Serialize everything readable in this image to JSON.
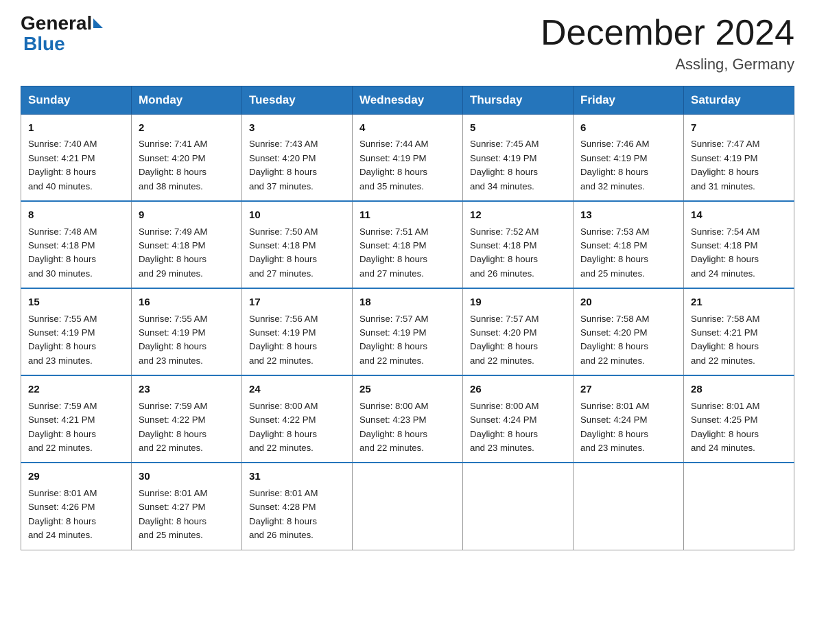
{
  "header": {
    "logo_general": "General",
    "logo_blue": "Blue",
    "month_title": "December 2024",
    "location": "Assling, Germany"
  },
  "weekdays": [
    "Sunday",
    "Monday",
    "Tuesday",
    "Wednesday",
    "Thursday",
    "Friday",
    "Saturday"
  ],
  "weeks": [
    [
      {
        "day": "1",
        "sunrise": "7:40 AM",
        "sunset": "4:21 PM",
        "daylight": "8 hours and 40 minutes."
      },
      {
        "day": "2",
        "sunrise": "7:41 AM",
        "sunset": "4:20 PM",
        "daylight": "8 hours and 38 minutes."
      },
      {
        "day": "3",
        "sunrise": "7:43 AM",
        "sunset": "4:20 PM",
        "daylight": "8 hours and 37 minutes."
      },
      {
        "day": "4",
        "sunrise": "7:44 AM",
        "sunset": "4:19 PM",
        "daylight": "8 hours and 35 minutes."
      },
      {
        "day": "5",
        "sunrise": "7:45 AM",
        "sunset": "4:19 PM",
        "daylight": "8 hours and 34 minutes."
      },
      {
        "day": "6",
        "sunrise": "7:46 AM",
        "sunset": "4:19 PM",
        "daylight": "8 hours and 32 minutes."
      },
      {
        "day": "7",
        "sunrise": "7:47 AM",
        "sunset": "4:19 PM",
        "daylight": "8 hours and 31 minutes."
      }
    ],
    [
      {
        "day": "8",
        "sunrise": "7:48 AM",
        "sunset": "4:18 PM",
        "daylight": "8 hours and 30 minutes."
      },
      {
        "day": "9",
        "sunrise": "7:49 AM",
        "sunset": "4:18 PM",
        "daylight": "8 hours and 29 minutes."
      },
      {
        "day": "10",
        "sunrise": "7:50 AM",
        "sunset": "4:18 PM",
        "daylight": "8 hours and 27 minutes."
      },
      {
        "day": "11",
        "sunrise": "7:51 AM",
        "sunset": "4:18 PM",
        "daylight": "8 hours and 27 minutes."
      },
      {
        "day": "12",
        "sunrise": "7:52 AM",
        "sunset": "4:18 PM",
        "daylight": "8 hours and 26 minutes."
      },
      {
        "day": "13",
        "sunrise": "7:53 AM",
        "sunset": "4:18 PM",
        "daylight": "8 hours and 25 minutes."
      },
      {
        "day": "14",
        "sunrise": "7:54 AM",
        "sunset": "4:18 PM",
        "daylight": "8 hours and 24 minutes."
      }
    ],
    [
      {
        "day": "15",
        "sunrise": "7:55 AM",
        "sunset": "4:19 PM",
        "daylight": "8 hours and 23 minutes."
      },
      {
        "day": "16",
        "sunrise": "7:55 AM",
        "sunset": "4:19 PM",
        "daylight": "8 hours and 23 minutes."
      },
      {
        "day": "17",
        "sunrise": "7:56 AM",
        "sunset": "4:19 PM",
        "daylight": "8 hours and 22 minutes."
      },
      {
        "day": "18",
        "sunrise": "7:57 AM",
        "sunset": "4:19 PM",
        "daylight": "8 hours and 22 minutes."
      },
      {
        "day": "19",
        "sunrise": "7:57 AM",
        "sunset": "4:20 PM",
        "daylight": "8 hours and 22 minutes."
      },
      {
        "day": "20",
        "sunrise": "7:58 AM",
        "sunset": "4:20 PM",
        "daylight": "8 hours and 22 minutes."
      },
      {
        "day": "21",
        "sunrise": "7:58 AM",
        "sunset": "4:21 PM",
        "daylight": "8 hours and 22 minutes."
      }
    ],
    [
      {
        "day": "22",
        "sunrise": "7:59 AM",
        "sunset": "4:21 PM",
        "daylight": "8 hours and 22 minutes."
      },
      {
        "day": "23",
        "sunrise": "7:59 AM",
        "sunset": "4:22 PM",
        "daylight": "8 hours and 22 minutes."
      },
      {
        "day": "24",
        "sunrise": "8:00 AM",
        "sunset": "4:22 PM",
        "daylight": "8 hours and 22 minutes."
      },
      {
        "day": "25",
        "sunrise": "8:00 AM",
        "sunset": "4:23 PM",
        "daylight": "8 hours and 22 minutes."
      },
      {
        "day": "26",
        "sunrise": "8:00 AM",
        "sunset": "4:24 PM",
        "daylight": "8 hours and 23 minutes."
      },
      {
        "day": "27",
        "sunrise": "8:01 AM",
        "sunset": "4:24 PM",
        "daylight": "8 hours and 23 minutes."
      },
      {
        "day": "28",
        "sunrise": "8:01 AM",
        "sunset": "4:25 PM",
        "daylight": "8 hours and 24 minutes."
      }
    ],
    [
      {
        "day": "29",
        "sunrise": "8:01 AM",
        "sunset": "4:26 PM",
        "daylight": "8 hours and 24 minutes."
      },
      {
        "day": "30",
        "sunrise": "8:01 AM",
        "sunset": "4:27 PM",
        "daylight": "8 hours and 25 minutes."
      },
      {
        "day": "31",
        "sunrise": "8:01 AM",
        "sunset": "4:28 PM",
        "daylight": "8 hours and 26 minutes."
      },
      null,
      null,
      null,
      null
    ]
  ]
}
